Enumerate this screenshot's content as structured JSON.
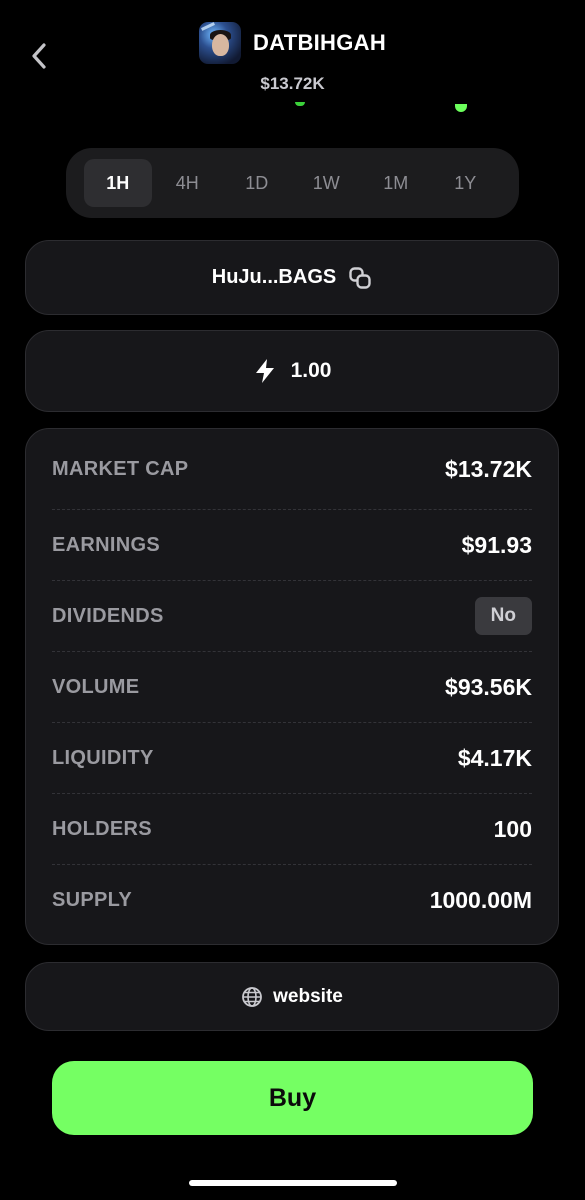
{
  "header": {
    "token_name": "DATBIHGAH",
    "token_price": "$13.72K"
  },
  "timeframes": {
    "options": [
      "1H",
      "4H",
      "1D",
      "1W",
      "1M",
      "1Y"
    ],
    "selected": "1H"
  },
  "address": {
    "label": "HuJu...BAGS"
  },
  "amount": {
    "value": "1.00"
  },
  "stats": {
    "market_cap": {
      "label": "MARKET CAP",
      "value": "$13.72K"
    },
    "earnings": {
      "label": "EARNINGS",
      "value": "$91.93"
    },
    "dividends": {
      "label": "DIVIDENDS",
      "value": "No"
    },
    "volume": {
      "label": "VOLUME",
      "value": "$93.56K"
    },
    "liquidity": {
      "label": "LIQUIDITY",
      "value": "$4.17K"
    },
    "holders": {
      "label": "HOLDERS",
      "value": "100"
    },
    "supply": {
      "label": "SUPPLY",
      "value": "1000.00M"
    }
  },
  "website": {
    "label": "website"
  },
  "buy": {
    "label": "Buy"
  },
  "colors": {
    "accent_green": "#75ff63",
    "background": "#000000",
    "card": "#17171a"
  },
  "icons": [
    "chevron-left-icon",
    "copy-icon",
    "lightning-icon",
    "globe-icon"
  ]
}
